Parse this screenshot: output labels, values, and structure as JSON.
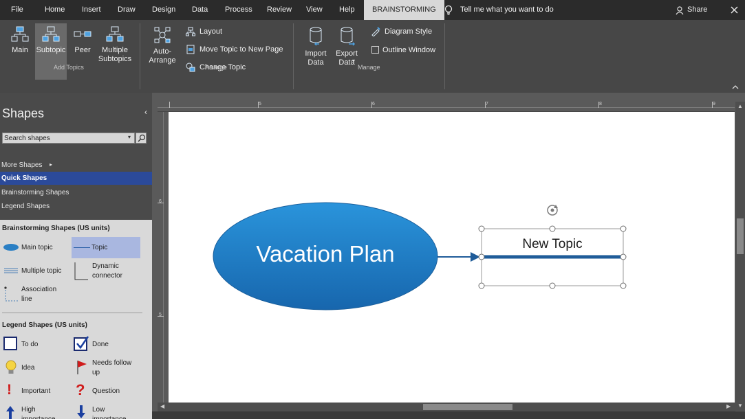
{
  "menu": {
    "tabs": [
      "File",
      "Home",
      "Insert",
      "Draw",
      "Design",
      "Data",
      "Process",
      "Review",
      "View",
      "Help"
    ],
    "active_tab": "BRAINSTORMING",
    "tell_me": "Tell me what you want to do",
    "share": "Share"
  },
  "ribbon": {
    "add_topics": {
      "label": "Add Topics",
      "main": "Main",
      "subtopic": "Subtopic",
      "peer": "Peer",
      "multiple": "Multiple Subtopics"
    },
    "arrange": {
      "label": "Arrange",
      "auto": "Auto-Arrange",
      "layout": "Layout",
      "move": "Move Topic to New Page",
      "change": "Change Topic"
    },
    "manage": {
      "label": "Manage",
      "import": "Import Data",
      "export": "Export Data",
      "style": "Diagram Style",
      "outline": "Outline Window"
    }
  },
  "shapes_panel": {
    "title": "Shapes",
    "search_placeholder": "Search shapes",
    "more": "More Shapes",
    "quick": "Quick Shapes",
    "brainstorming": "Brainstorming Shapes",
    "legend": "Legend Shapes"
  },
  "stencil": {
    "brainstorm_header": "Brainstorming Shapes (US units)",
    "main_topic": "Main topic",
    "topic": "Topic",
    "multiple_topic": "Multiple topic",
    "dynamic_connector": "Dynamic connector",
    "association_line": "Association line",
    "legend_header": "Legend Shapes (US units)",
    "todo": "To do",
    "done": "Done",
    "idea": "Idea",
    "needs_follow_up": "Needs follow up",
    "important": "Important",
    "question": "Question",
    "high_importance": "High importance",
    "low_importance": "Low importance"
  },
  "ruler": {
    "labels": [
      "5",
      "6",
      "7",
      "8",
      "9"
    ],
    "v_labels": [
      "6",
      "5"
    ]
  },
  "diagram": {
    "main_topic": "Vacation Plan",
    "new_topic": "New Topic"
  },
  "colors": {
    "accent": "#1f5c99",
    "ellipse_light": "#2a8fd6",
    "ellipse_dark": "#1a69b0",
    "quick_shapes_bg": "#2b4a9a"
  }
}
